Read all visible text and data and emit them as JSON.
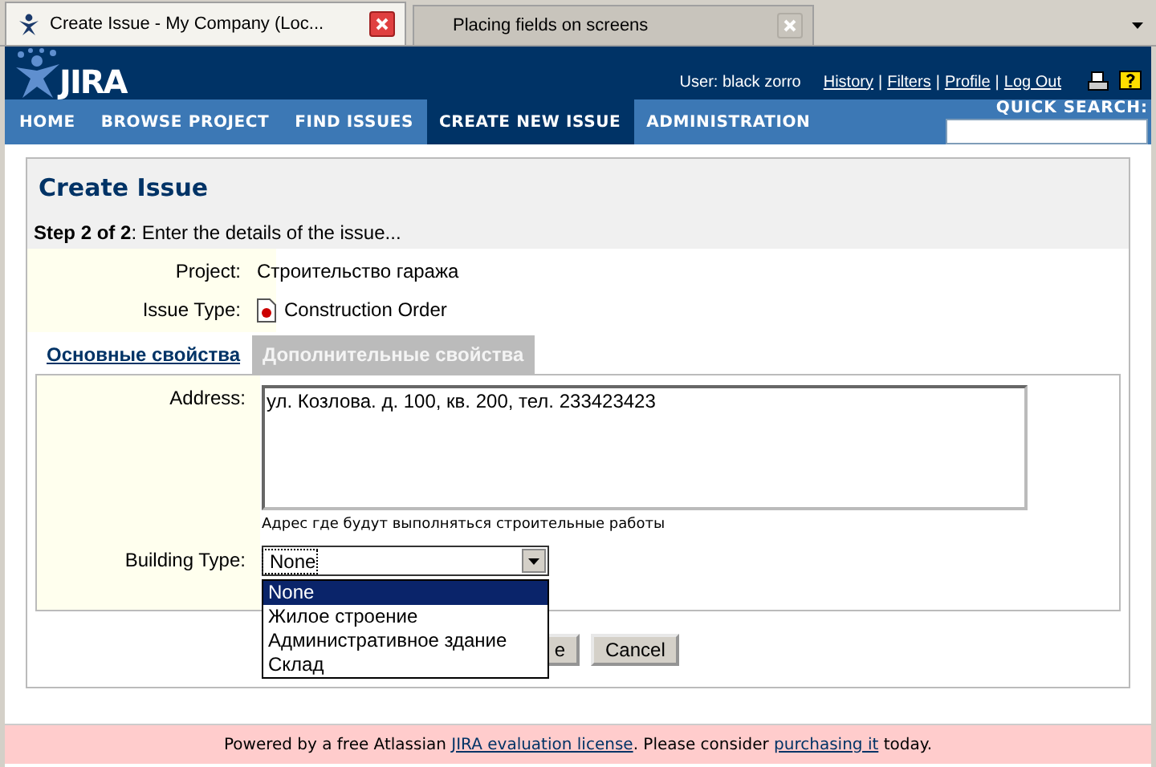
{
  "browser_tabs": [
    {
      "title": "Create Issue - My Company (Loc...",
      "selected": true
    },
    {
      "title": "Placing fields on screens",
      "selected": false
    }
  ],
  "header": {
    "logo": "JIRA",
    "user": "User: black zorro",
    "links": [
      "History",
      "Filters",
      "Profile",
      "Log Out"
    ],
    "separator": "|"
  },
  "nav": [
    {
      "label": "HOME",
      "selected": false
    },
    {
      "label": "BROWSE PROJECT",
      "selected": false
    },
    {
      "label": "FIND ISSUES",
      "selected": false
    },
    {
      "label": "CREATE NEW ISSUE",
      "selected": true
    },
    {
      "label": "ADMINISTRATION",
      "selected": false
    }
  ],
  "quick_search": {
    "label": "QUICK SEARCH:"
  },
  "page": {
    "title": "Create Issue",
    "step": "**Step 2 of 2**: Enter the details of the issue..."
  },
  "info_rows": [
    {
      "label": "Project:",
      "value": "Строительство гаража",
      "kind": "text"
    },
    {
      "label": "Issue Type:",
      "value": "Construction Order",
      "kind": "issue-type"
    }
  ],
  "form_tabs": [
    {
      "label": "Основные свойства",
      "selected": false
    },
    {
      "label": "Дополнительные свойства",
      "selected": true
    }
  ],
  "address": {
    "label": "Address:",
    "value": "ул. Козлова. д. 100, кв. 200, тел. 233423423",
    "hint": "Адрес где будут выполняться строительные работы"
  },
  "building_type": {
    "label": "Building Type:",
    "value": "None",
    "expanded": true,
    "options": [
      {
        "label": "None",
        "selected": true
      },
      {
        "label": "Жилое строение",
        "selected": false
      },
      {
        "label": "Административное здание",
        "selected": false
      },
      {
        "label": "Склад",
        "selected": false
      }
    ]
  },
  "buttons": [
    "e",
    "Cancel"
  ],
  "footer": {
    "before": "Powered by a free Atlassian ",
    "link1": "JIRA evaluation license",
    "middle": ". Please consider ",
    "link2": "purchasing it",
    "after": " today."
  }
}
